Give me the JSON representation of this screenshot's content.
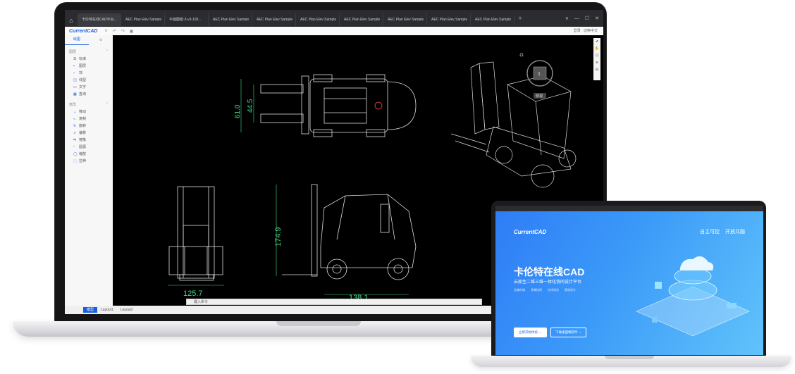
{
  "desktop_app": {
    "tabs": [
      "卡伦特在线CAD平台...",
      "AEC Plan Elev Sample",
      "平面图纸-3-v3-193...",
      "AEC Plan Elev Sample",
      "AEC Plan Elev Sample",
      "AEC Plan Elev Sample",
      "AEC Plan Elev Sample",
      "AEC Plan Elev Sample",
      "AEC Plan Elev Sample",
      "AEC Plan Elev Sample"
    ],
    "tab_add": "+",
    "window_controls": [
      "∨",
      "—",
      "☐",
      "✕"
    ],
    "toolbar": {
      "logo": "CurrentCAD",
      "right_labels": [
        "登录",
        "切换中文"
      ]
    },
    "sidebar": {
      "tabs": [
        "绘图",
        "⚙"
      ],
      "draw_section": "图层",
      "draw_items": [
        "标准",
        "图层",
        "块",
        "线型",
        "文字",
        "查询"
      ],
      "modify_section": "修改",
      "modify_items": [
        "移动",
        "复制",
        "旋转",
        "偏移",
        "镜像",
        "圆弧",
        "缩放",
        "拉伸"
      ]
    },
    "dimensions": [
      "61.0",
      "44.5",
      "174.9",
      "125.7",
      "138.1"
    ],
    "cmd_placeholder": "键入命令",
    "layout_tabs": [
      "模型",
      "Layout1",
      "Layout2"
    ],
    "view_cube_label": "1",
    "view_button": "俯视"
  },
  "web_app": {
    "logo": "CurrentCAD",
    "nav": [
      "自主可控",
      "开放共融"
    ],
    "title": "卡伦特在线CAD",
    "subtitle": "云原生二维三维一体化协同设计平台",
    "features": [
      "云端存储",
      "多端协同",
      "在线浏览",
      "高效设计"
    ],
    "buttons": [
      "立即开始体验 →",
      "下载桌面端软件 →"
    ]
  }
}
